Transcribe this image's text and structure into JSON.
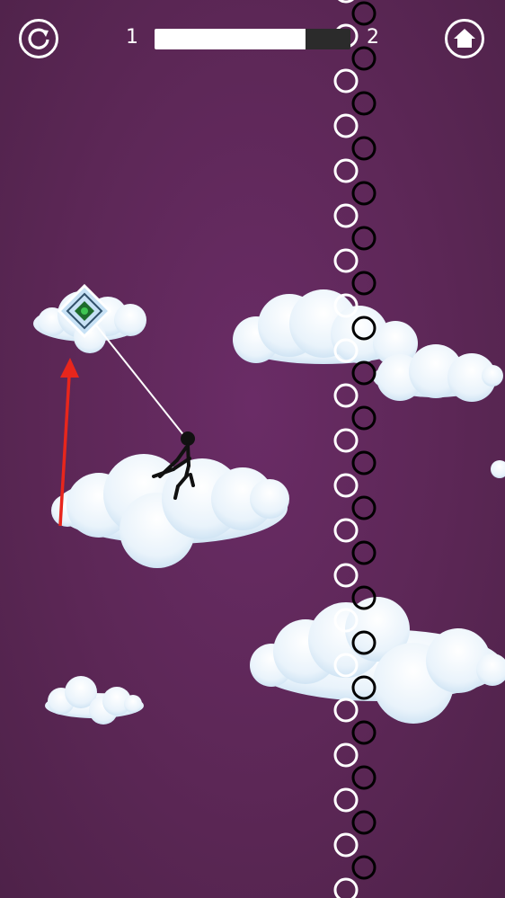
{
  "hud": {
    "current_level": "1",
    "next_level": "2",
    "progress_fraction": 0.77,
    "restart_icon": "restart-icon",
    "home_icon": "home-icon"
  },
  "scene": {
    "background_color": "#5e2858",
    "rope_color": "#ffffff",
    "arrow_color": "#e8261c",
    "player_color": "#111111",
    "wall": {
      "white_ring_color": "#ffffff",
      "black_ring_color": "#000000"
    }
  }
}
